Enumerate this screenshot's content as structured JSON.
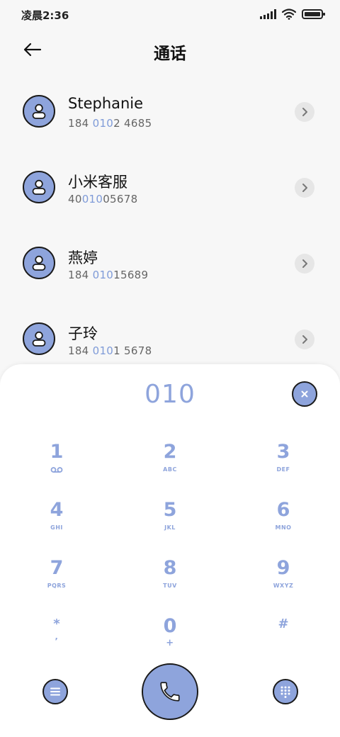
{
  "status": {
    "time": "凌晨2:36"
  },
  "header": {
    "title": "通话"
  },
  "contacts": [
    {
      "name": "Stephanie",
      "number_pre": "184 ",
      "number_match": "010",
      "number_post": "2 4685"
    },
    {
      "name": "小米客服",
      "number_pre": "40",
      "number_match": "010",
      "number_post": "05678"
    },
    {
      "name": "燕婷",
      "number_pre": "184 ",
      "number_match": "010",
      "number_post": "15689"
    },
    {
      "name": "子玲",
      "number_pre": "184 ",
      "number_match": "010",
      "number_post": "1 5678"
    }
  ],
  "dialpad": {
    "dialed": "010",
    "keys": [
      {
        "digit": "1",
        "letters": ""
      },
      {
        "digit": "2",
        "letters": "ABC"
      },
      {
        "digit": "3",
        "letters": "DEF"
      },
      {
        "digit": "4",
        "letters": "GHI"
      },
      {
        "digit": "5",
        "letters": "JKL"
      },
      {
        "digit": "6",
        "letters": "MNO"
      },
      {
        "digit": "7",
        "letters": "PQRS"
      },
      {
        "digit": "8",
        "letters": "TUV"
      },
      {
        "digit": "9",
        "letters": "WXYZ"
      },
      {
        "digit": "*",
        "letters": ","
      },
      {
        "digit": "0",
        "letters": "+"
      },
      {
        "digit": "#",
        "letters": ""
      }
    ]
  },
  "colors": {
    "accent": "#8ea4dc",
    "background": "#f7f7f7",
    "sheet": "#ffffff",
    "outline": "#1a1a1a"
  },
  "icons": {
    "back": "arrow-left-icon",
    "avatar": "person-icon",
    "detail": "chevron-right-icon",
    "clear": "close-icon",
    "voicemail": "voicemail-icon",
    "menu": "menu-icon",
    "call": "phone-icon",
    "keypad": "dialpad-grid-icon"
  }
}
